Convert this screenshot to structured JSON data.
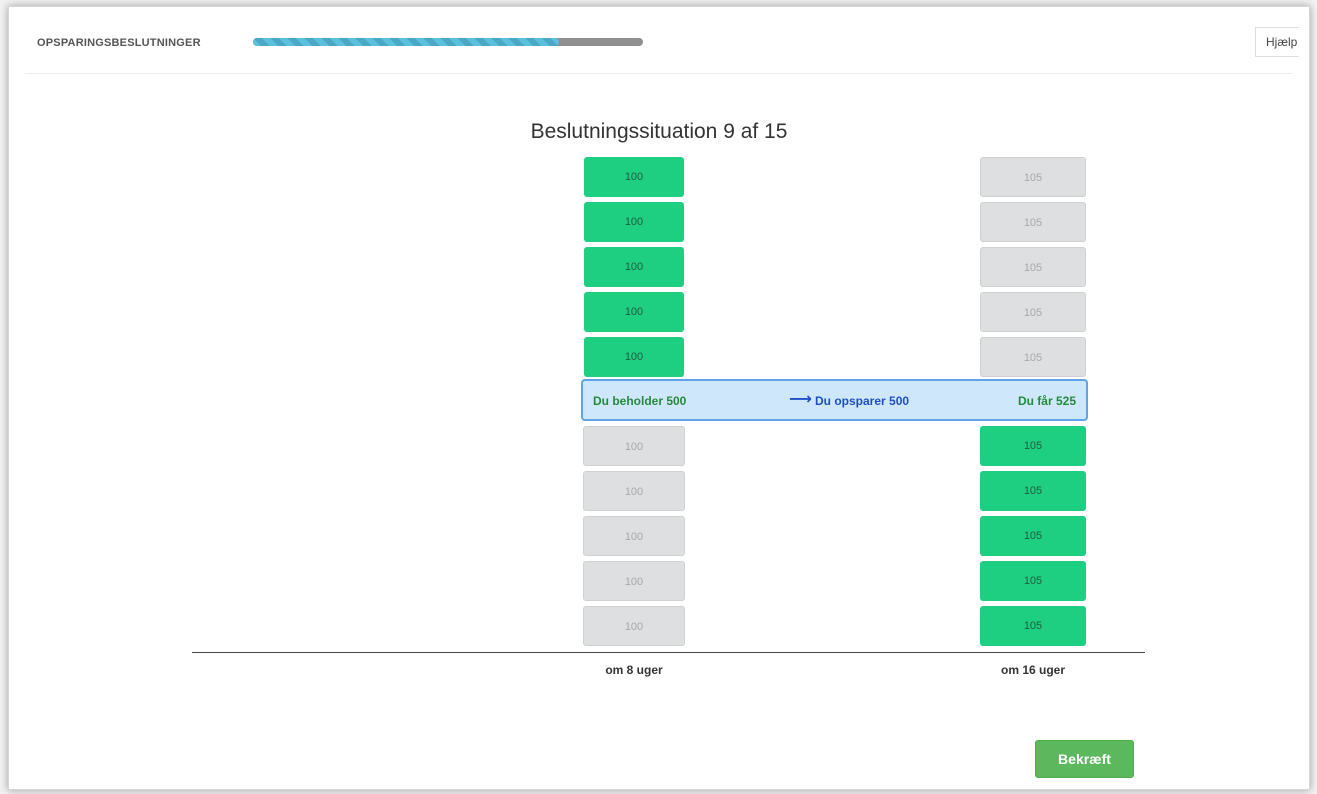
{
  "header": {
    "app_title": "OPSPARINGSBESLUTNINGER",
    "progress_fraction": 0.785,
    "help_label": "Hjælp"
  },
  "heading": "Beslutningssituation 9 af 15",
  "early_column": {
    "label": "om 8 uger",
    "upper_values": [
      "100",
      "100",
      "100",
      "100",
      "100"
    ],
    "lower_values": [
      "100",
      "100",
      "100",
      "100",
      "100"
    ],
    "upper_state": "selected",
    "lower_state": "unselected"
  },
  "late_column": {
    "label": "om 16 uger",
    "upper_values": [
      "105",
      "105",
      "105",
      "105",
      "105"
    ],
    "lower_values": [
      "105",
      "105",
      "105",
      "105",
      "105"
    ],
    "upper_state": "unselected",
    "lower_state": "selected"
  },
  "summary": {
    "keep_text": "Du beholder 500",
    "save_text": "Du opsparer 500",
    "get_text": "Du får 525",
    "arrow_icon": "arrow-right-icon"
  },
  "confirm_label": "Bekræft",
  "colors": {
    "selected_green": "#1ecf82",
    "unselected_grey": "#dedfe1",
    "summary_bg": "#cfe7fb",
    "summary_border": "#5ea4e6",
    "confirm_green": "#5cb85c",
    "progress_blue": "#5bc0de"
  }
}
